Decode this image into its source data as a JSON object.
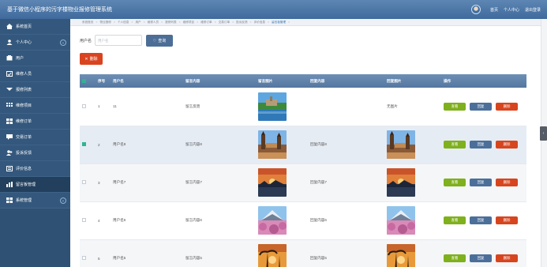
{
  "app": {
    "title": "基于微信小程序的污字楼物业报修管理系统"
  },
  "header": {
    "links": [
      "首页",
      "个人中心",
      "退出登录"
    ]
  },
  "sidebar": {
    "items": [
      {
        "label": "系统首页",
        "icon": "home-icon"
      },
      {
        "label": "个人中心",
        "icon": "user-icon",
        "expandable": true
      },
      {
        "label": "用户",
        "icon": "users-icon"
      },
      {
        "label": "维修人员",
        "icon": "wrench-icon"
      },
      {
        "label": "报修列表",
        "icon": "list-icon"
      },
      {
        "label": "维修项目",
        "icon": "grid-icon"
      },
      {
        "label": "维修订单",
        "icon": "order-icon"
      },
      {
        "label": "交易订单",
        "icon": "trade-icon"
      },
      {
        "label": "投诉反馈",
        "icon": "complaint-icon"
      },
      {
        "label": "评价信息",
        "icon": "rating-icon"
      },
      {
        "label": "留言板管理",
        "icon": "message-icon",
        "active": true
      },
      {
        "label": "系统管理",
        "icon": "settings-icon",
        "expandable": true
      }
    ]
  },
  "breadcrumbs": [
    "系统首页",
    "物业报修",
    "个人信息",
    "用户",
    "维修人员",
    "报修列表",
    "维修项目",
    "维修订单",
    "交易订单",
    "投诉反馈",
    "评价信息",
    "留言板管理"
  ],
  "search": {
    "label": "用户名",
    "placeholder": "用户名",
    "button": "查询"
  },
  "toolbar": {
    "delete_label": "删除"
  },
  "table": {
    "columns": [
      "",
      "序号",
      "用户名",
      "留言内容",
      "留言图片",
      "回复内容",
      "回复图片",
      "操作"
    ],
    "actions": {
      "view": "查看",
      "reply": "回复",
      "delete": "删除"
    },
    "rows": [
      {
        "index": "1",
        "username": "11",
        "content": "留言反馈",
        "image": "lake-castle",
        "reply": "",
        "reply_image": "",
        "reply_image_text": "无图片",
        "checked": false
      },
      {
        "index": "2",
        "username": "用户名8",
        "content": "留言内容8",
        "image": "prague-bridge",
        "reply": "回复内容8",
        "reply_image": "prague-bridge",
        "reply_image_text": "",
        "checked": true
      },
      {
        "index": "3",
        "username": "用户名7",
        "content": "留言内容7",
        "image": "sunset",
        "reply": "回复内容7",
        "reply_image": "sunset",
        "reply_image_text": "",
        "checked": false
      },
      {
        "index": "4",
        "username": "用户名6",
        "content": "留言内容6",
        "image": "fuji-blossom",
        "reply": "回复内容6",
        "reply_image": "fuji-blossom",
        "reply_image_text": "",
        "checked": false
      },
      {
        "index": "5",
        "username": "用户名5",
        "content": "留言内容5",
        "image": "palm-sunset",
        "reply": "回复内容5",
        "reply_image": "palm-sunset",
        "reply_image_text": "",
        "checked": false
      }
    ]
  },
  "colors": {
    "header": "#4a73a3",
    "sidebar": "#2f5173",
    "view": "#7fb01d",
    "reply": "#4b6f99",
    "delete": "#d7451f"
  }
}
